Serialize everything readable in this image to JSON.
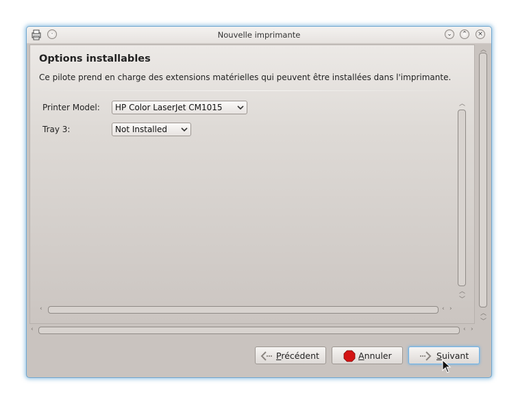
{
  "window": {
    "title": "Nouvelle imprimante"
  },
  "page": {
    "heading": "Options installables",
    "description": "Ce pilote prend en charge des extensions matérielles qui peuvent être installées dans l'imprimante."
  },
  "options": [
    {
      "label": "Printer Model:",
      "value": "HP Color LaserJet CM1015"
    },
    {
      "label": "Tray 3:",
      "value": "Not Installed"
    }
  ],
  "buttons": {
    "back": {
      "prefix": "",
      "mnemonic": "P",
      "rest": "récédent"
    },
    "cancel": {
      "prefix": "",
      "mnemonic": "A",
      "rest": "nnuler"
    },
    "next": {
      "prefix": "",
      "mnemonic": "S",
      "rest": "uivant"
    }
  },
  "colors": {
    "focus": "#6fb2e6",
    "cancel_icon": "#d41414",
    "window_border": "#6fa6cf"
  },
  "icons": {
    "window": "printer-icon",
    "back": "arrow-left-icon",
    "cancel": "stop-icon",
    "next": "arrow-right-icon"
  }
}
